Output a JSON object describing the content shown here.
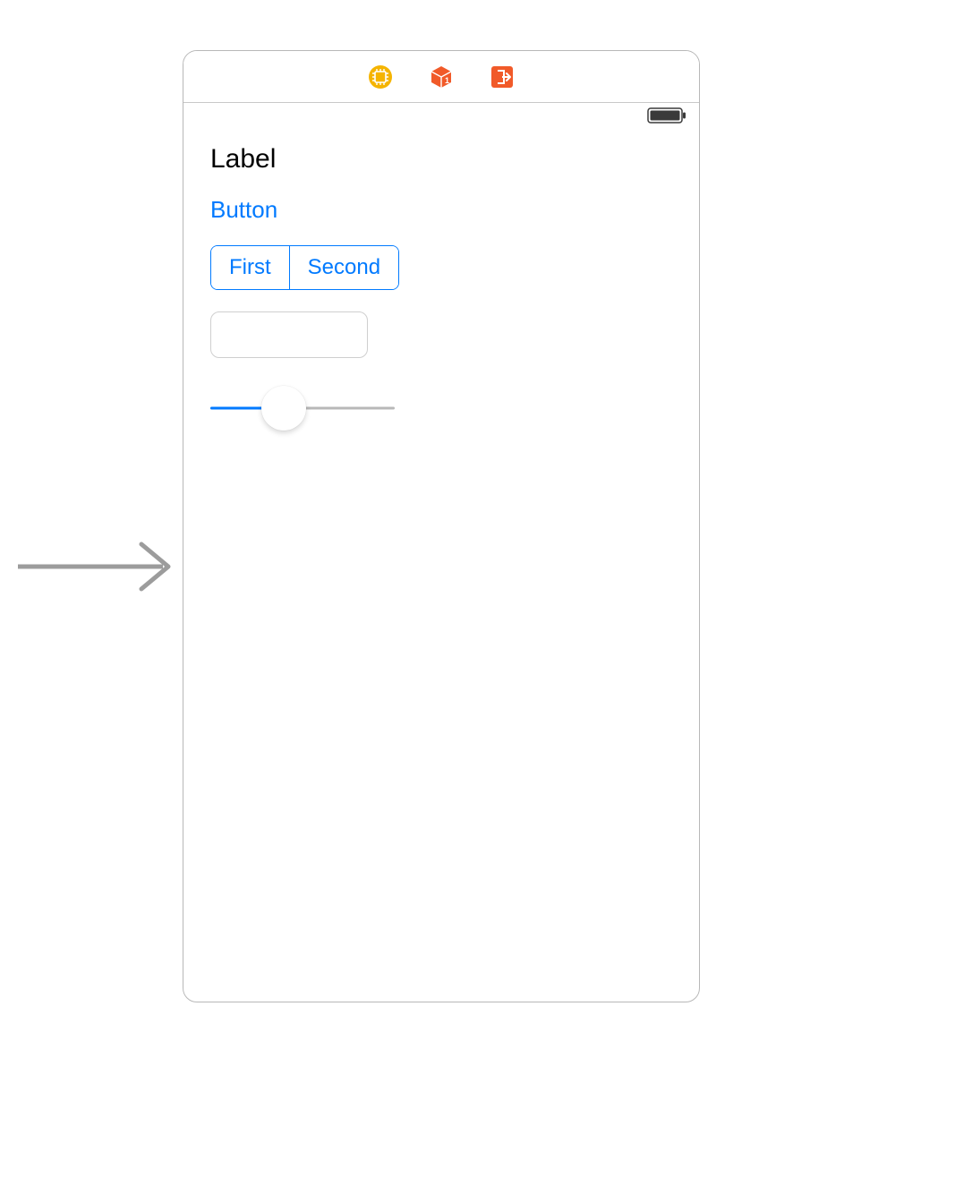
{
  "toolbar": {
    "icons": [
      "chip-icon",
      "cube-icon",
      "exit-icon"
    ]
  },
  "status_bar": {
    "battery_level": 100
  },
  "content": {
    "label_text": "Label",
    "button_label": "Button",
    "segments": [
      "First",
      "Second"
    ],
    "textfield_value": "",
    "textfield_placeholder": "",
    "slider_value": 0.4,
    "slider_min": 0,
    "slider_max": 1
  },
  "colors": {
    "tint": "#007aff",
    "toolbar_yellow": "#f5b400",
    "toolbar_orange": "#f15a29"
  }
}
